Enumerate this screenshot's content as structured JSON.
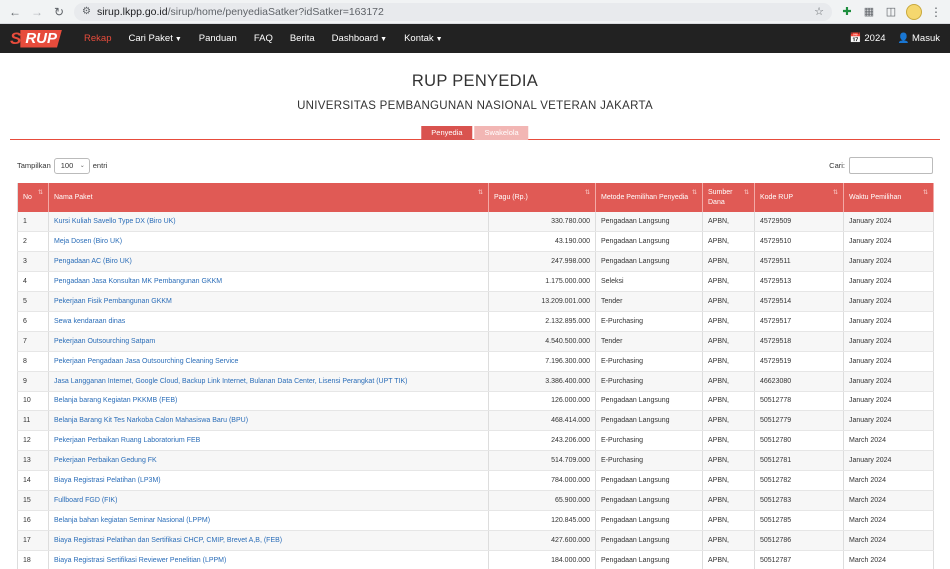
{
  "browser": {
    "url_host": "sirup.lkpp.go.id",
    "url_path": "/sirup/home/penyediaSatker?idSatker=163172"
  },
  "navbar": {
    "logo_prefix": "S",
    "logo_main": "RUP",
    "menu": [
      "Rekap",
      "Cari Paket",
      "Panduan",
      "FAQ",
      "Berita",
      "Dashboard",
      "Kontak"
    ],
    "year": "2024",
    "login": "Masuk"
  },
  "page": {
    "title": "RUP PENYEDIA",
    "subtitle": "UNIVERSITAS PEMBANGUNAN NASIONAL VETERAN JAKARTA",
    "tabs": [
      "Penyedia",
      "Swakelola"
    ]
  },
  "controls": {
    "show_label": "Tampilkan",
    "entries_value": "100",
    "entries_label": "entri",
    "search_label": "Cari:"
  },
  "table": {
    "headers": [
      "No",
      "Nama Paket",
      "Pagu (Rp.)",
      "Metode Pemilihan Penyedia",
      "Sumber Dana",
      "Kode RUP",
      "Waktu Pemilihan"
    ],
    "rows": [
      [
        "1",
        "Kursi Kuliah Savello Type DX (Biro UK)",
        "330.780.000",
        "Pengadaan Langsung",
        "APBN,",
        "45729509",
        "January 2024"
      ],
      [
        "2",
        "Meja Dosen (Biro UK)",
        "43.190.000",
        "Pengadaan Langsung",
        "APBN,",
        "45729510",
        "January 2024"
      ],
      [
        "3",
        "Pengadaan AC (Biro UK)",
        "247.998.000",
        "Pengadaan Langsung",
        "APBN,",
        "45729511",
        "January 2024"
      ],
      [
        "4",
        "Pengadaan Jasa Konsultan MK Pembangunan GKKM",
        "1.175.000.000",
        "Seleksi",
        "APBN,",
        "45729513",
        "January 2024"
      ],
      [
        "5",
        "Pekerjaan Fisik Pembangunan GKKM",
        "13.209.001.000",
        "Tender",
        "APBN,",
        "45729514",
        "January 2024"
      ],
      [
        "6",
        "Sewa kendaraan dinas",
        "2.132.895.000",
        "E-Purchasing",
        "APBN,",
        "45729517",
        "January 2024"
      ],
      [
        "7",
        "Pekerjaan Outsourching Satpam",
        "4.540.500.000",
        "Tender",
        "APBN,",
        "45729518",
        "January 2024"
      ],
      [
        "8",
        "Pekerjaan Pengadaan Jasa Outsourching Cleaning Service",
        "7.196.300.000",
        "E-Purchasing",
        "APBN,",
        "45729519",
        "January 2024"
      ],
      [
        "9",
        "Jasa Langganan Internet, Google Cloud, Backup Link Internet, Bulanan Data Center, Lisensi Perangkat (UPT TIK)",
        "3.386.400.000",
        "E-Purchasing",
        "APBN,",
        "46623080",
        "January 2024"
      ],
      [
        "10",
        "Belanja barang Kegiatan PKKMB (FEB)",
        "126.000.000",
        "Pengadaan Langsung",
        "APBN,",
        "50512778",
        "January 2024"
      ],
      [
        "11",
        "Belanja Barang Kit Tes Narkoba Calon Mahasiswa Baru (BPU)",
        "468.414.000",
        "Pengadaan Langsung",
        "APBN,",
        "50512779",
        "January 2024"
      ],
      [
        "12",
        "Pekerjaan Perbaikan Ruang Laboratorium FEB",
        "243.206.000",
        "E-Purchasing",
        "APBN,",
        "50512780",
        "March 2024"
      ],
      [
        "13",
        "Pekerjaan Perbaikan Gedung FK",
        "514.709.000",
        "E-Purchasing",
        "APBN,",
        "50512781",
        "January 2024"
      ],
      [
        "14",
        "Biaya Registrasi Pelatihan (LP3M)",
        "784.000.000",
        "Pengadaan Langsung",
        "APBN,",
        "50512782",
        "March 2024"
      ],
      [
        "15",
        "Fullboard FGD (FIK)",
        "65.900.000",
        "Pengadaan Langsung",
        "APBN,",
        "50512783",
        "March 2024"
      ],
      [
        "16",
        "Belanja bahan kegiatan Seminar Nasional (LPPM)",
        "120.845.000",
        "Pengadaan Langsung",
        "APBN,",
        "50512785",
        "March 2024"
      ],
      [
        "17",
        "Biaya Registrasi Pelatihan dan Sertifikasi CHCP, CMIP, Brevet A,B, (FEB)",
        "427.600.000",
        "Pengadaan Langsung",
        "APBN,",
        "50512786",
        "March 2024"
      ],
      [
        "18",
        "Biaya Registrasi Sertifikasi Reviewer Penelitian (LPPM)",
        "184.000.000",
        "Pengadaan Langsung",
        "APBN,",
        "50512787",
        "March 2024"
      ]
    ]
  }
}
